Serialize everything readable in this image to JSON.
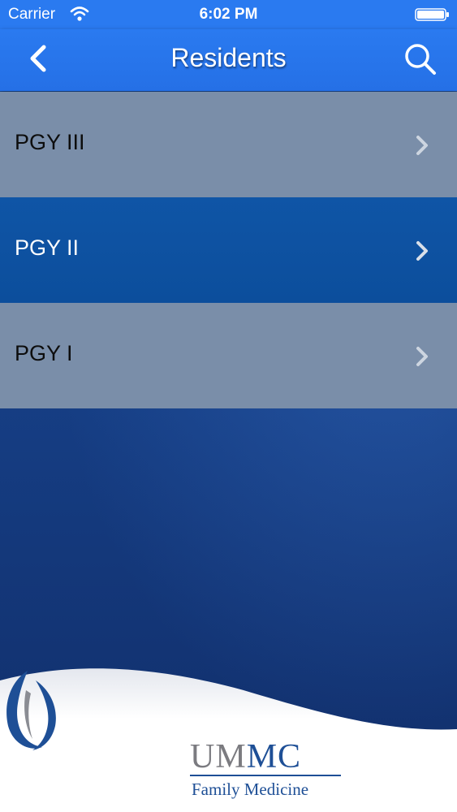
{
  "status_bar": {
    "carrier": "Carrier",
    "time": "6:02 PM"
  },
  "nav": {
    "title": "Residents",
    "back_icon": "chevron-left-icon",
    "search_icon": "search-icon"
  },
  "menu": {
    "items": [
      {
        "label": "PGY III",
        "style": "light"
      },
      {
        "label": "PGY II",
        "style": "dark"
      },
      {
        "label": "PGY I",
        "style": "light"
      }
    ]
  },
  "footer": {
    "logo_text_gray": "UM",
    "logo_text_blue": "MC",
    "logo_subtitle": "Family Medicine"
  },
  "colors": {
    "nav_blue": "#2a7af0",
    "row_light": "#7a8ea9",
    "row_dark": "#0f55a6",
    "brand_blue": "#1e4f96"
  }
}
